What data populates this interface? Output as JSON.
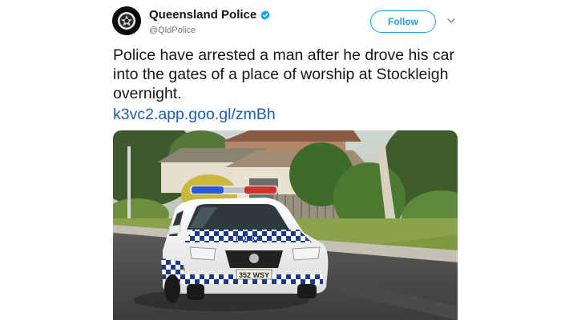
{
  "account": {
    "name": "Queensland Police",
    "handle": "@QldPolice"
  },
  "follow_label": "Follow",
  "tweet": {
    "text": "Police have arrested a man after he drove his car into the gates of a place of worship at Stockleigh overnight.",
    "link": "k3vc2.app.goo.gl/zmBh"
  },
  "photo": {
    "car_livery_text": "POLICE",
    "plate": "352 WSY"
  },
  "colors": {
    "accent": "#1da1f2",
    "link": "#1b5fa8",
    "police_blue": "#1a3a8c"
  }
}
